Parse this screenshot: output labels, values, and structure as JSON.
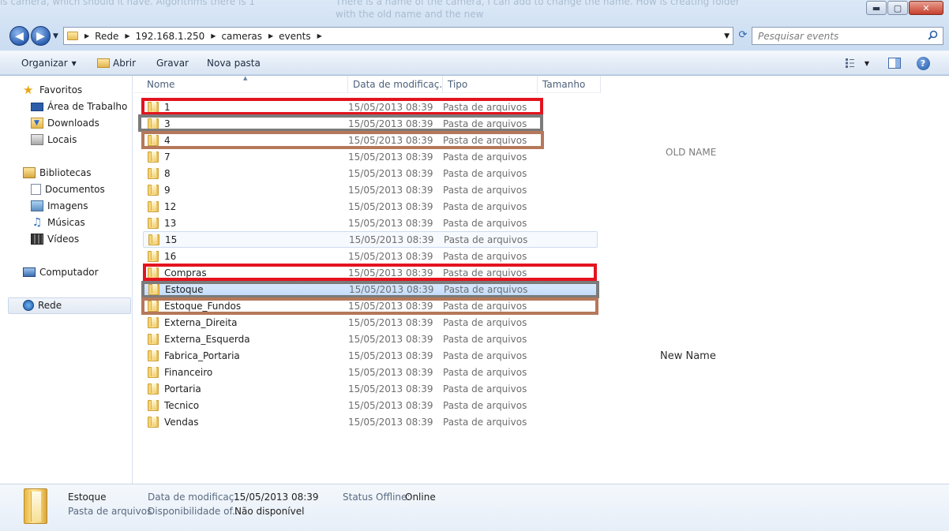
{
  "ghost_text": {
    "line1a": "is camera, which should it have. Algorithms there is 1",
    "line1b": "There is a name of the camera, I can add to change the name. How is creating folder",
    "line2": "with the old name and the new"
  },
  "navigation": {
    "breadcrumbs": [
      "Rede",
      "192.168.1.250",
      "cameras",
      "events"
    ],
    "search_placeholder": "Pesquisar events"
  },
  "toolbar": {
    "organize_label": "Organizar",
    "open_label": "Abrir",
    "burn_label": "Gravar",
    "new_folder_label": "Nova pasta"
  },
  "sidebar": {
    "favorites_label": "Favoritos",
    "favorites": [
      "Área de Trabalho",
      "Downloads",
      "Locais"
    ],
    "libraries_label": "Bibliotecas",
    "libraries": [
      "Documentos",
      "Imagens",
      "Músicas",
      "Vídeos"
    ],
    "computer_label": "Computador",
    "network_label": "Rede"
  },
  "columns": {
    "name": "Nome",
    "date": "Data de modificaç...",
    "type": "Tipo",
    "size": "Tamanho"
  },
  "files": [
    {
      "name": "1",
      "date": "15/05/2013 08:39",
      "type": "Pasta de arquivos"
    },
    {
      "name": "3",
      "date": "15/05/2013 08:39",
      "type": "Pasta de arquivos"
    },
    {
      "name": "4",
      "date": "15/05/2013 08:39",
      "type": "Pasta de arquivos"
    },
    {
      "name": "7",
      "date": "15/05/2013 08:39",
      "type": "Pasta de arquivos"
    },
    {
      "name": "8",
      "date": "15/05/2013 08:39",
      "type": "Pasta de arquivos"
    },
    {
      "name": "9",
      "date": "15/05/2013 08:39",
      "type": "Pasta de arquivos"
    },
    {
      "name": "12",
      "date": "15/05/2013 08:39",
      "type": "Pasta de arquivos"
    },
    {
      "name": "13",
      "date": "15/05/2013 08:39",
      "type": "Pasta de arquivos"
    },
    {
      "name": "15",
      "date": "15/05/2013 08:39",
      "type": "Pasta de arquivos"
    },
    {
      "name": "16",
      "date": "15/05/2013 08:39",
      "type": "Pasta de arquivos"
    },
    {
      "name": "Compras",
      "date": "15/05/2013 08:39",
      "type": "Pasta de arquivos"
    },
    {
      "name": "Estoque",
      "date": "15/05/2013 08:39",
      "type": "Pasta de arquivos"
    },
    {
      "name": "Estoque_Fundos",
      "date": "15/05/2013 08:39",
      "type": "Pasta de arquivos"
    },
    {
      "name": "Externa_Direita",
      "date": "15/05/2013 08:39",
      "type": "Pasta de arquivos"
    },
    {
      "name": "Externa_Esquerda",
      "date": "15/05/2013 08:39",
      "type": "Pasta de arquivos"
    },
    {
      "name": "Fabrica_Portaria",
      "date": "15/05/2013 08:39",
      "type": "Pasta de arquivos"
    },
    {
      "name": "Financeiro",
      "date": "15/05/2013 08:39",
      "type": "Pasta de arquivos"
    },
    {
      "name": "Portaria",
      "date": "15/05/2013 08:39",
      "type": "Pasta de arquivos"
    },
    {
      "name": "Tecnico",
      "date": "15/05/2013 08:39",
      "type": "Pasta de arquivos"
    },
    {
      "name": "Vendas",
      "date": "15/05/2013 08:39",
      "type": "Pasta de arquivos"
    }
  ],
  "annotations": {
    "old_name": "OLD NAME",
    "new_name": "New Name",
    "box_colors": {
      "red": "#e3141f",
      "gray": "#7b7b7b",
      "brown": "#b5785a"
    }
  },
  "details": {
    "name": "Estoque",
    "type": "Pasta de arquivos",
    "date_label": "Data de modificaç...",
    "date_value": "15/05/2013 08:39",
    "availability_label": "Disponibilidade of...",
    "availability_value": "Não disponível",
    "offline_label": "Status Offline:",
    "offline_value": "Online"
  },
  "window_buttons": {
    "minimize": "▬",
    "maximize": "▢",
    "close": "✕"
  }
}
